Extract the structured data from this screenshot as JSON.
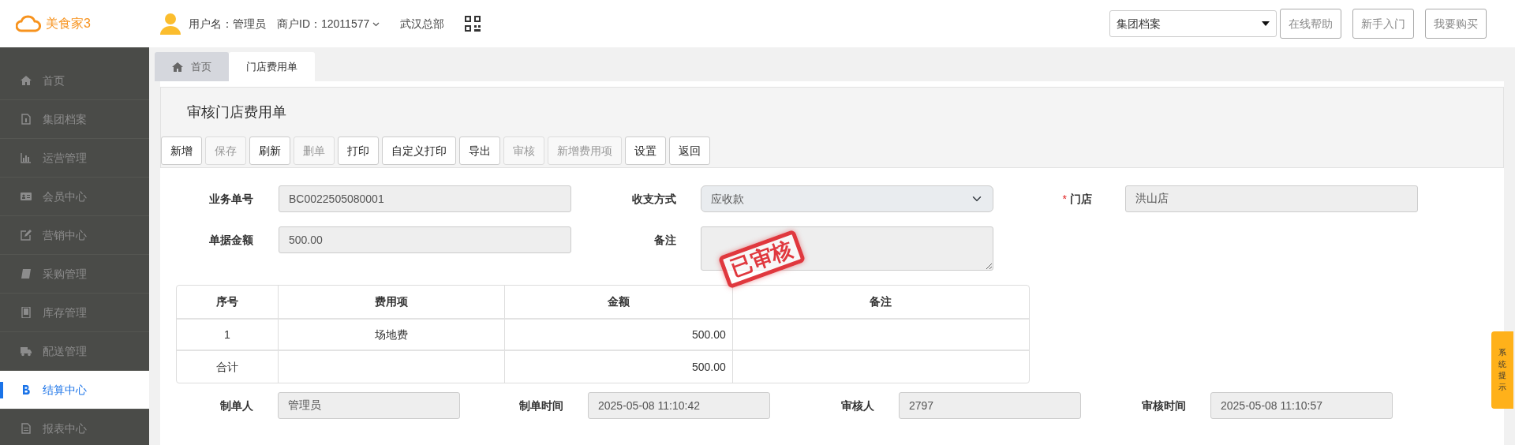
{
  "header": {
    "logo": "美食家3",
    "user": "用户名：管理员",
    "merchant": "商户ID：12011577",
    "store": "武汉总部",
    "archive_select": "集团档案",
    "buttons": [
      "在线帮助",
      "新手入门",
      "我要购买"
    ]
  },
  "sidebar": {
    "items": [
      {
        "label": "首页",
        "selected": false
      },
      {
        "label": "集团档案",
        "selected": false
      },
      {
        "label": "运营管理",
        "selected": false
      },
      {
        "label": "会员中心",
        "selected": false
      },
      {
        "label": "营销中心",
        "selected": false
      },
      {
        "label": "采购管理",
        "selected": false
      },
      {
        "label": "库存管理",
        "selected": false
      },
      {
        "label": "配送管理",
        "selected": false
      },
      {
        "label": "结算中心",
        "selected": true
      },
      {
        "label": "报表中心",
        "selected": false
      }
    ]
  },
  "tabs": [
    {
      "label": "首页",
      "kind": "home",
      "selected": false
    },
    {
      "label": "门店费用单",
      "kind": "page",
      "selected": true
    }
  ],
  "page_title": "审核门店费用单",
  "toolbar": [
    {
      "label": "新增",
      "disabled": false
    },
    {
      "label": "保存",
      "disabled": true
    },
    {
      "label": "刷新",
      "disabled": false
    },
    {
      "label": "删单",
      "disabled": true
    },
    {
      "label": "打印",
      "disabled": false
    },
    {
      "label": "自定义打印",
      "disabled": false
    },
    {
      "label": "导出",
      "disabled": false
    },
    {
      "label": "审核",
      "disabled": true
    },
    {
      "label": "新增费用项",
      "disabled": true
    },
    {
      "label": "设置",
      "disabled": false
    },
    {
      "label": "返回",
      "disabled": false
    }
  ],
  "form": {
    "rows": [
      [
        {
          "label": "业务单号",
          "kind": "input",
          "value": "BC0022505080001"
        },
        {
          "label": "收支方式",
          "kind": "select",
          "value": "应收款"
        },
        {
          "label": "门店",
          "kind": "input",
          "value": "洪山店",
          "marker": "*"
        }
      ],
      [
        {
          "label": "单据金额",
          "kind": "input",
          "value": "500.00"
        },
        {
          "label": "备注",
          "kind": "textarea",
          "stamp": "已审核"
        }
      ]
    ]
  },
  "table": {
    "columns": [
      "序号",
      "费用项",
      "金额",
      "备注"
    ],
    "rows": [
      {
        "number": "1",
        "item": "场地费",
        "amount": "500.00"
      }
    ],
    "footer": {
      "label": "合计",
      "amount": "500.00"
    }
  },
  "bottom_fields": [
    {
      "label": "制单人",
      "value": "管理员"
    },
    {
      "label": "制单时间",
      "value": "2025-05-08 11:10:42"
    },
    {
      "label": "审核人",
      "value": "2797"
    },
    {
      "label": "审核时间",
      "value": "2025-05-08 11:10:57"
    }
  ],
  "side_tab": "系统提示"
}
